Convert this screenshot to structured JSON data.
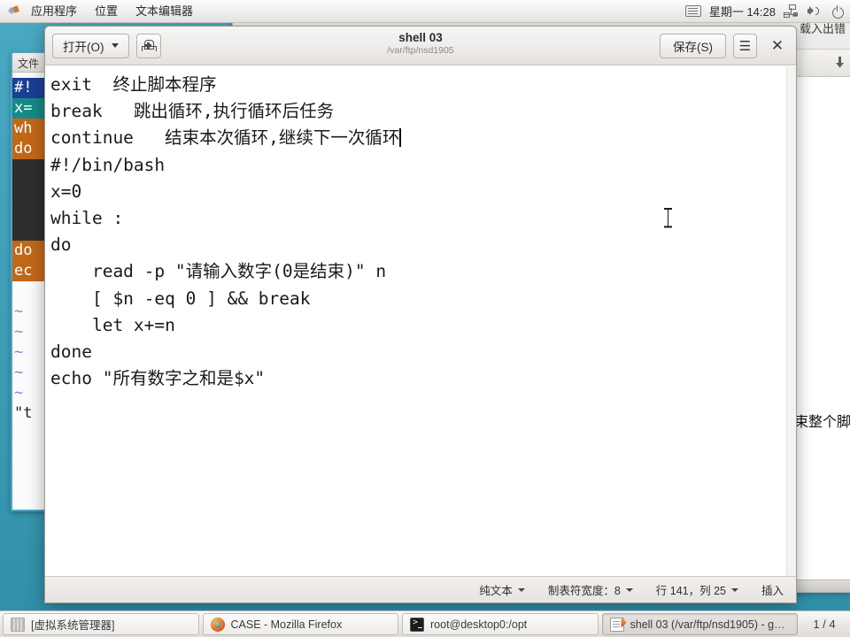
{
  "panel": {
    "menus": [
      "应用程序",
      "位置",
      "文本编辑器"
    ],
    "clock": "星期一 14:28",
    "icons": [
      "keyboard-icon",
      "network-icon",
      "volume-icon",
      "power-icon"
    ]
  },
  "gedit": {
    "open_label": "打开(O)",
    "new_doc_icon": "new-document-icon",
    "title": "shell 03",
    "subtitle": "/var/ftp/nsd1905",
    "save_label": "保存(S)",
    "menu_icon": "hamburger-menu-icon",
    "close_icon": "close-icon",
    "content": "exit  终止脚本程序\nbreak   跳出循环,执行循环后任务\ncontinue   结束本次循环,继续下一次循环",
    "content2": "#!/bin/bash\nx=0\nwhile :\ndo\n    read -p \"请输入数字(0是结束)\" n\n    [ $n -eq 0 ] && break\n    let x+=n\ndone\necho \"所有数字之和是$x\"",
    "status": {
      "language": "纯文本",
      "tab_width": "制表符宽度：8",
      "position": "行 141，列 25",
      "mode": "插入"
    }
  },
  "terminal_bg": {
    "title": "文件",
    "lines": [
      {
        "text": "#!",
        "style": "vl-blue"
      },
      {
        "text": "x=",
        "style": "vl-teal"
      },
      {
        "text": "wh",
        "style": "vl-orange"
      },
      {
        "text": "do",
        "style": "vl-orange"
      },
      {
        "text": "",
        "style": "vl-dark"
      },
      {
        "text": "",
        "style": "vl-dark"
      },
      {
        "text": "",
        "style": "vl-dark"
      },
      {
        "text": "",
        "style": "vl-redbox"
      },
      {
        "text": "do",
        "style": "vl-orange"
      },
      {
        "text": "ec",
        "style": "vl-orange"
      },
      {
        "text": "",
        "style": "vl-plain"
      },
      {
        "text": "~",
        "style": "vl-tilde"
      },
      {
        "text": "~",
        "style": "vl-tilde"
      },
      {
        "text": "~",
        "style": "vl-tilde"
      },
      {
        "text": "~",
        "style": "vl-tilde"
      },
      {
        "text": "~",
        "style": "vl-tilde"
      },
      {
        "text": "\"t",
        "style": "vl-plain"
      }
    ]
  },
  "firefox_bg": {
    "error_text": "载入出错",
    "body_text": "束整个脚",
    "download_icon": "download-arrow-icon"
  },
  "taskbar": {
    "items": [
      {
        "label": "[虚拟系统管理器]",
        "icon": "virt-manager-icon",
        "active": false
      },
      {
        "label": "CASE - Mozilla Firefox",
        "icon": "firefox-icon",
        "active": false
      },
      {
        "label": "root@desktop0:/opt",
        "icon": "terminal-icon",
        "active": false
      },
      {
        "label": "shell 03 (/var/ftp/nsd1905) - g…",
        "icon": "gedit-icon",
        "active": true
      }
    ],
    "workspace": "1 / 4"
  }
}
